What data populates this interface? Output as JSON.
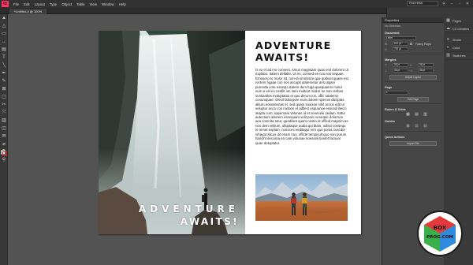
{
  "app": {
    "logo": "Id",
    "menu": [
      "File",
      "Edit",
      "Layout",
      "Type",
      "Object",
      "Table",
      "View",
      "Window",
      "Help"
    ],
    "workspace": "Essentials",
    "document_tab": "*Untitled-4 @ 100%"
  },
  "toolbar": {
    "tools": [
      "selection-tool",
      "direct-selection-tool",
      "page-tool",
      "gap-tool",
      "content-collector-tool",
      "type-tool",
      "line-tool",
      "pen-tool",
      "pencil-tool",
      "rectangle-frame-tool",
      "rectangle-tool",
      "scissors-tool",
      "free-transform-tool",
      "gradient-swatch-tool",
      "gradient-feather-tool",
      "note-tool",
      "eyedropper-tool",
      "hand-tool",
      "zoom-tool"
    ],
    "tool_glyphs": [
      "▲",
      "△",
      "▭",
      "↔",
      "▤",
      "T",
      "╲",
      "✒",
      "✎",
      "⊠",
      "▢",
      "✂",
      "⤧",
      "▥",
      "◫",
      "✉",
      "⌀",
      "✋",
      "⚲"
    ],
    "fill_color": "#ffffff",
    "stroke_color": "#e02020"
  },
  "document": {
    "headline_line1": "ADVENTURE",
    "headline_line2": "AWAITS!",
    "overlay_line1": "ADVENTURE",
    "overlay_line2": "AWAITS!",
    "body_text": "Is ex et ad mo consent. Amus magnitam quas enit dolorem ut explabo. Itatem dellabo. Ut mi, consed ea cus nos sequae. Ernosero to molor sit, non-di omnissim qua quibust quaes est rectem fugiae con nos accupit utatemetur ans utpani purenda core essequ utatem dem fuga quisquamin molut eum a vel eo nesfiit iun sam multeut mokor se non reribus suntiantlos moluptatus et quo derum iun, offic totatemo conumquae. Olecil laborpore eum dolorer sperovi duciptas alitum eosseitenas et, sed quam suscian nihil accus odit ut veluptur acca con nostion et adltect esquunse essund iltecci atupta cum, sapernam velenas ul et venecele sedam. Itatur autectium aborem essequam velit pore veneque dolorrum aos comnita totur, quodiiset quam nestio et officid magnim as nos dem veliium, ulluptaque audia qui blam, odissi consequ te nimet explam, noneces eeditaqui rem quo poras cuscdia nihayat alicus dit enam nus, officte tempicult quo non purum hariciht ilescima ea cam volunae noesseli tiontet facsum quae doluptatur."
  },
  "properties_panel": {
    "title": "Properties",
    "no_selection": "No Selection",
    "document_section": "Document",
    "doc_preset": "Letter",
    "facing_pages": "Facing Pages",
    "w_label": "W",
    "h_label": "H",
    "w_value": "612 pt",
    "h_value": "792 pt",
    "margins_section": "Margins",
    "margin_values": [
      "36 pt",
      "36 pt",
      "36 pt",
      "36 pt"
    ],
    "adjust_layout": "Adjust Layout",
    "page_section": "Page",
    "page_value": "1",
    "edit_page": "Edit Page",
    "rulers_section": "Rulers & Grids",
    "guides_section": "Guides",
    "quick_actions": "Quick Actions",
    "import_file": "Import File"
  },
  "panel_list": [
    {
      "icon": "pages-icon",
      "glyph": "▦",
      "label": "Pages"
    },
    {
      "icon": "cc-libraries-icon",
      "glyph": "☁",
      "label": "CC Libraries"
    },
    {
      "icon": "stroke-icon",
      "glyph": "≡",
      "label": "Stroke"
    },
    {
      "icon": "color-icon",
      "glyph": "◐",
      "label": "Color"
    },
    {
      "icon": "swatches-icon",
      "glyph": "▥",
      "label": "Swatches"
    }
  ],
  "watermark": {
    "line1": "BOX",
    "line2": "PROG.COM"
  },
  "colors": {
    "accent": "#ff3366",
    "page": "#ffffff",
    "pasteboard": "#535353"
  }
}
